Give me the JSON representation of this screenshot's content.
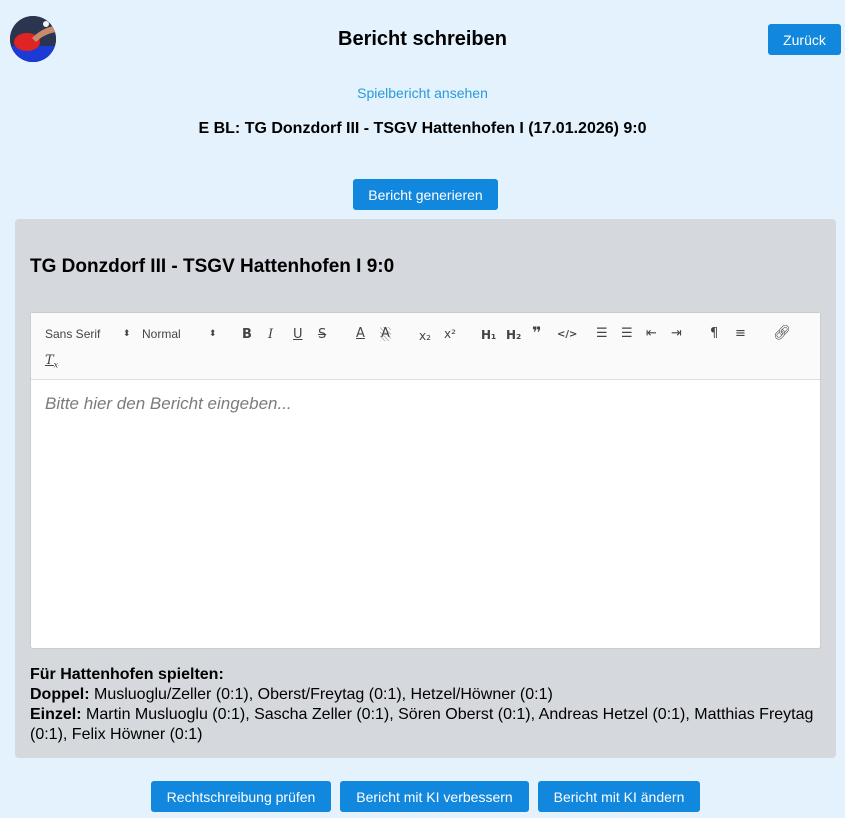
{
  "header": {
    "title": "Bericht schreiben",
    "back_label": "Zurück"
  },
  "links": {
    "report": "Spielbericht ansehen"
  },
  "match": {
    "heading": "E BL: TG Donzdorf III - TSGV Hattenhofen I (17.01.2026) 9:0"
  },
  "actions": {
    "generate": "Bericht generieren",
    "spell_check": "Rechtschreibung prüfen",
    "ai_improve": "Bericht mit KI verbessern",
    "ai_change": "Bericht mit KI ändern"
  },
  "panel": {
    "title": "TG Donzdorf III - TSGV Hattenhofen I 9:0"
  },
  "editor": {
    "font_select": "Sans Serif",
    "size_select": "Normal",
    "placeholder": "Bitte hier den Bericht eingeben..."
  },
  "players": {
    "heading": "Für Hattenhofen spielten:",
    "doubles_label": "Doppel:",
    "doubles": "Musluoglu/Zeller (0:1), Oberst/Freytag (0:1), Hetzel/Höwner (0:1)",
    "singles_label": "Einzel:",
    "singles": "Martin Musluoglu (0:1), Sascha Zeller (0:1), Sören Oberst (0:1), Andreas Hetzel (0:1), Matthias Freytag (0:1), Felix Höwner (0:1)"
  },
  "colors": {
    "background": "#e3f2fd",
    "primary": "#1187dd",
    "link": "#2a9ad8",
    "panel": "#d5d8dc"
  }
}
